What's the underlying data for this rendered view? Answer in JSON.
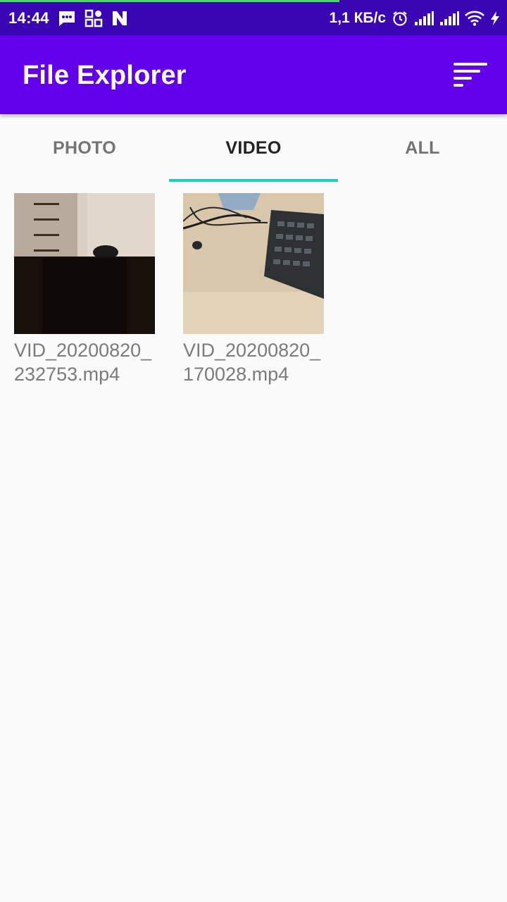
{
  "status_bar": {
    "time": "14:44",
    "network_speed": "1,1 КБ/с",
    "left_icons": [
      "message-icon",
      "grid-app-icon",
      "n-app-icon"
    ],
    "right_icons": [
      "alarm-icon",
      "signal-icon",
      "signal-icon",
      "wifi-icon",
      "charging-icon"
    ]
  },
  "app_bar": {
    "title": "File Explorer",
    "sort_icon": "sort-icon",
    "color": "#6200ea"
  },
  "tabs": {
    "items": [
      "PHOTO",
      "VIDEO",
      "ALL"
    ],
    "active": "VIDEO",
    "indicator_color": "#1ad2bd"
  },
  "files": [
    {
      "name": "VID_20200820_232753.mp4"
    },
    {
      "name": "VID_20200820_170028.mp4"
    }
  ]
}
